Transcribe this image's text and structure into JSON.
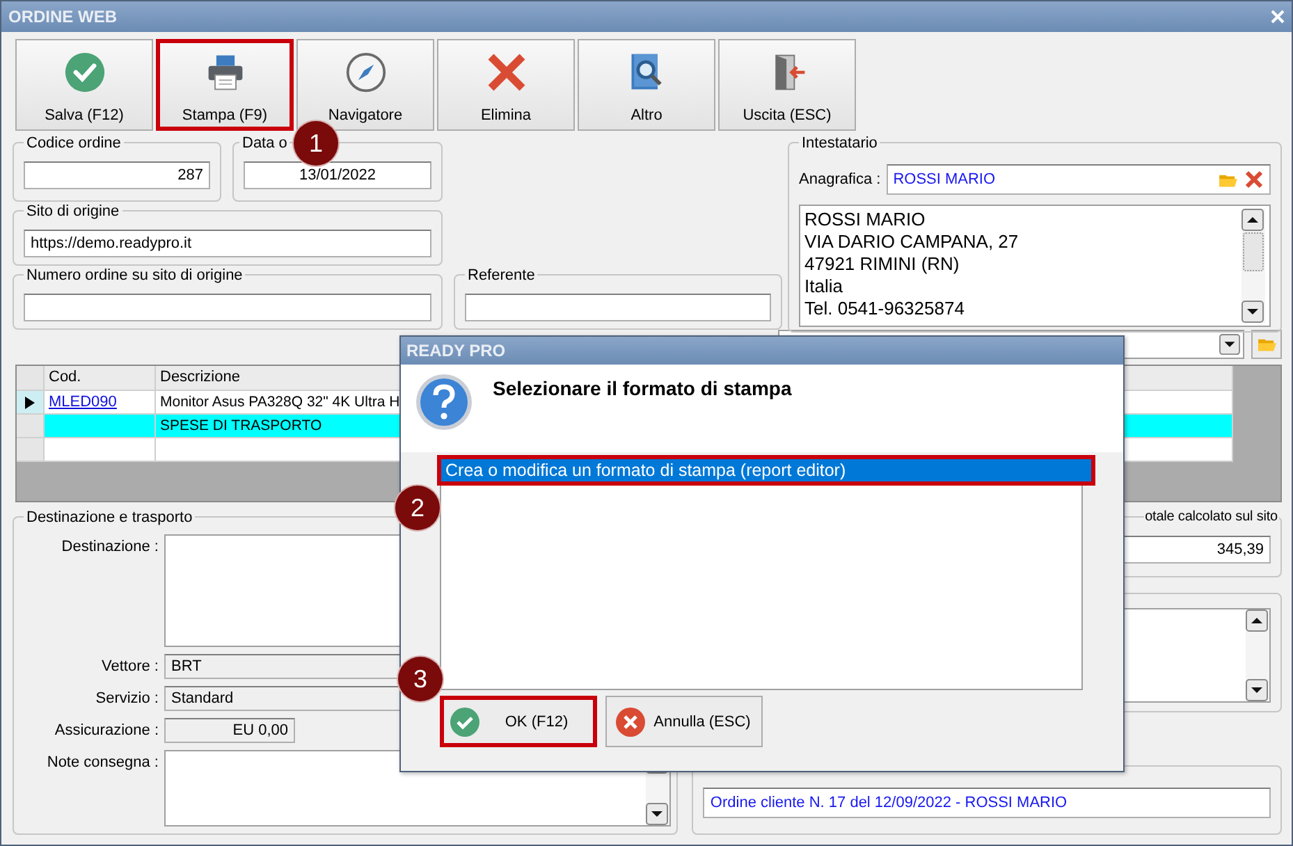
{
  "window": {
    "title": "ORDINE WEB"
  },
  "toolbar": [
    {
      "label": "Salva (F12)",
      "kind": "save",
      "highlighted": false
    },
    {
      "label": "Stampa (F9)",
      "kind": "print",
      "highlighted": true
    },
    {
      "label": "Navigatore",
      "kind": "navigator",
      "highlighted": false
    },
    {
      "label": "Elimina",
      "kind": "delete",
      "highlighted": false
    },
    {
      "label": "Altro",
      "kind": "other",
      "highlighted": false
    },
    {
      "label": "Uscita (ESC)",
      "kind": "exit",
      "highlighted": false
    }
  ],
  "order": {
    "codice_ordine": {
      "label": "Codice ordine",
      "value": "287"
    },
    "data_ordine": {
      "label": "Data o",
      "value": "13/01/2022"
    },
    "sito_di_origine": {
      "label": "Sito di origine",
      "value": "https://demo.readypro.it"
    },
    "numero_ordine_sito": {
      "label": "Numero ordine su sito di origine"
    },
    "referente": {
      "label": "Referente"
    }
  },
  "intestatario": {
    "title": "Intestatario",
    "anagrafica_label": "Anagrafica :",
    "anagrafica_value": "ROSSI MARIO",
    "address_lines": [
      "ROSSI MARIO",
      "VIA DARIO CAMPANA, 27",
      "47921 RIMINI (RN)",
      "Italia",
      "Tel. 0541-96325874"
    ]
  },
  "items_table": {
    "columns": [
      "Cod.",
      "Descrizione"
    ],
    "rows": [
      {
        "code": "MLED090",
        "description": "Monitor Asus PA328Q 32\" 4K Ultra H",
        "current": true,
        "highlighted": false
      },
      {
        "description": "SPESE DI TRASPORTO",
        "current": false,
        "highlighted": true
      },
      {
        "current": false,
        "highlighted": false
      }
    ]
  },
  "destinazione": {
    "title": "Destinazione e trasporto",
    "fields": [
      {
        "label": "Destinazione :",
        "kind": "memo"
      },
      {
        "label": "Vettore :",
        "kind": "readonly",
        "value": "BRT"
      },
      {
        "label": "Servizio :",
        "kind": "readonly",
        "value": "Standard"
      },
      {
        "label": "Assicurazione :",
        "kind": "amount",
        "value": "EU 0,00"
      },
      {
        "label": "Note consegna :",
        "kind": "scroll_memo"
      }
    ]
  },
  "totale": {
    "title": "otale calcolato sul sito",
    "value": "345,39"
  },
  "documento": {
    "value": "Ordine cliente N. 17 del 12/09/2022 - ROSSI MARIO"
  },
  "dialog": {
    "title": "READY PRO",
    "message": "Selezionare il formato di stampa",
    "options": [
      {
        "label": "Crea o modifica un formato di stampa (report editor)",
        "selected": true,
        "highlighted": true
      }
    ],
    "buttons": [
      {
        "label": "OK (F12)",
        "kind": "ok",
        "highlighted": true
      },
      {
        "label": "Annulla (ESC)",
        "kind": "cancel",
        "highlighted": false
      }
    ]
  },
  "callouts": [
    "1",
    "2",
    "3"
  ]
}
